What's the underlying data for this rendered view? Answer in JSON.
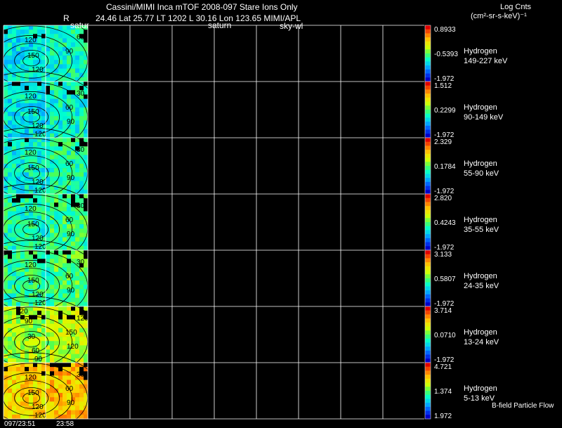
{
  "header": {
    "line1": "Cassini/MIMI Inca mTOF  2008-097   Stare   Ions Only",
    "line2_r": "R",
    "line2": "24.46 Lat 25.77 LT 1202 L     30.16 Lon      123.65  MIMI/APL",
    "overlap_labels": [
      "satur",
      "saturn",
      "sky-wl"
    ],
    "units_title": "Log Cnts",
    "units": "(cm²-sr-s-keV)⁻¹"
  },
  "footer": {
    "time_left": "097/23:51",
    "time_right": "23:58",
    "flow_label": "B-field Particle Flow"
  },
  "colorbar_colors": [
    "#0000c8",
    "#0050ff",
    "#00b4ff",
    "#00ffd0",
    "#50ff50",
    "#d8ff00",
    "#ffd000",
    "#ff7000",
    "#e00000"
  ],
  "chart_data": {
    "type": "heatmap",
    "panels": [
      {
        "species": "Hydrogen",
        "energy": "149-227 keV",
        "cbar_max": "0.8933",
        "cbar_mid": "-0.5393",
        "cbar_min": "-1.972",
        "level": 0.35,
        "contours": [
          "120",
          "60",
          "150",
          "90",
          "120"
        ]
      },
      {
        "species": "Hydrogen",
        "energy": "90-149 keV",
        "cbar_max": "1.512",
        "cbar_mid": "0.2299",
        "cbar_min": "-1.972",
        "level": 0.35,
        "contours": [
          "120",
          "30",
          "150",
          "60",
          "120",
          "90",
          "120"
        ]
      },
      {
        "species": "Hydrogen",
        "energy": "55-90 keV",
        "cbar_max": "2.329",
        "cbar_mid": "0.1784",
        "cbar_min": "-1.972",
        "level": 0.38,
        "contours": [
          "120",
          "30",
          "150",
          "60",
          "120",
          "90",
          "120"
        ]
      },
      {
        "species": "Hydrogen",
        "energy": "35-55 keV",
        "cbar_max": "2.820",
        "cbar_mid": "0.4243",
        "cbar_min": "-1.972",
        "level": 0.42,
        "contours": [
          "120",
          "30",
          "150",
          "60",
          "120",
          "90",
          "120"
        ]
      },
      {
        "species": "Hydrogen",
        "energy": "24-35 keV",
        "cbar_max": "3.133",
        "cbar_mid": "0.5807",
        "cbar_min": "-1.972",
        "level": 0.45,
        "contours": [
          "120",
          "30",
          "150",
          "60",
          "120",
          "90",
          "120"
        ]
      },
      {
        "species": "Hydrogen",
        "energy": "13-24 keV",
        "cbar_max": "3.714",
        "cbar_mid": "0.0710",
        "cbar_min": "-1.972",
        "level": 0.58,
        "contours": [
          "90",
          "120",
          "30",
          "150",
          "60",
          "120",
          "90",
          "120"
        ]
      },
      {
        "species": "Hydrogen",
        "energy": "5-13 keV",
        "cbar_max": "4.721",
        "cbar_mid": "1.374",
        "cbar_min": "1.972",
        "level": 0.74,
        "contours": [
          "120",
          "30",
          "150",
          "60",
          "120",
          "90",
          "120"
        ]
      }
    ]
  }
}
